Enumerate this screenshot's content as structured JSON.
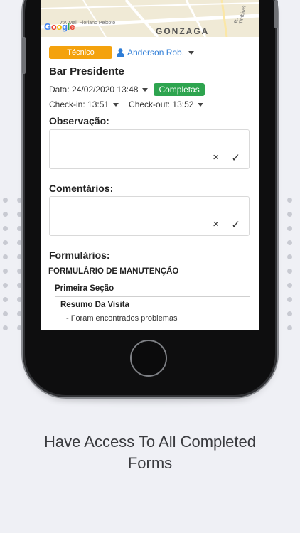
{
  "map": {
    "google_logo": "Google",
    "district": "GONZAGA",
    "street_1": "Av. Mal. Floriano Peixoto",
    "street_2": "R. Timbiras"
  },
  "visit": {
    "role_badge": "Técnico",
    "user_name": "Anderson Rob.",
    "place_title": "Bar Presidente",
    "date_label": "Data: 24/02/2020 13:48",
    "status_badge": "Completas",
    "checkin_label": "Check-in: 13:51",
    "checkout_label": "Check-out: 13:52"
  },
  "observacao": {
    "label": "Observação:",
    "value": "",
    "clear_icon": "×",
    "confirm_icon": "✓"
  },
  "comentarios": {
    "label": "Comentários:",
    "value": "",
    "clear_icon": "×",
    "confirm_icon": "✓"
  },
  "formularios": {
    "label": "Formulários:",
    "form_title": "FORMULÁRIO DE MANUTENÇÃO",
    "section_title": "Primeira Seção",
    "subsection_title": "Resumo Da Visita",
    "subsection_item": "- Foram encontrados problemas"
  },
  "caption": {
    "line1": "Have Access To All Completed",
    "line2": "Forms"
  },
  "colors": {
    "role_badge": "#f4a20d",
    "status_badge": "#2ea44f",
    "user_link": "#2e7dd7",
    "background": "#eff0f5"
  }
}
